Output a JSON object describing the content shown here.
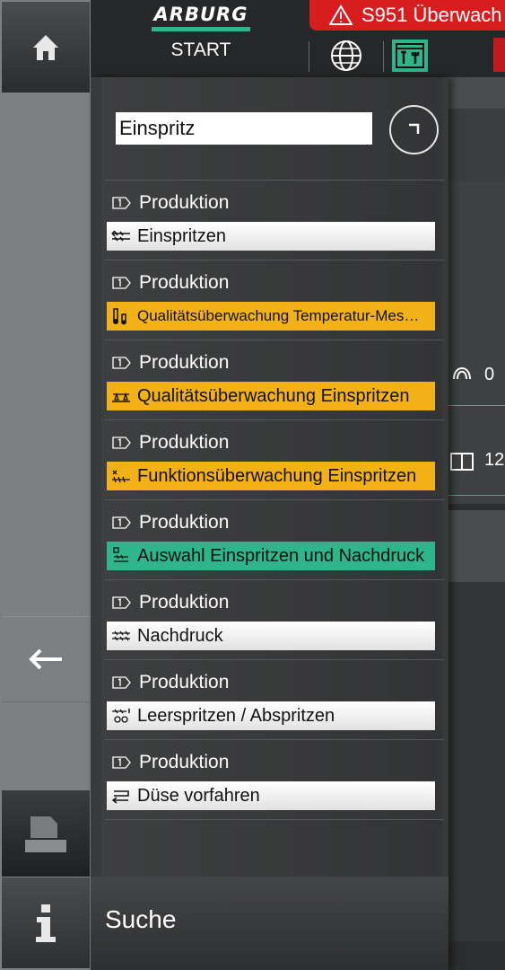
{
  "header": {
    "logo": "ARBURG",
    "start_label": "START",
    "alarm_text": "S951 Überwach"
  },
  "background": {
    "value_a": "0",
    "value_b": "12"
  },
  "search": {
    "value": "Einspritz"
  },
  "results": [
    {
      "crumb": "Produktion",
      "label": "Einspritzen",
      "style": "white",
      "icon": "injection-icon"
    },
    {
      "crumb": "Produktion",
      "label": "Qualitätsüberwachung Temperatur-Mes…",
      "style": "yellow",
      "icon": "temperature-icon"
    },
    {
      "crumb": "Produktion",
      "label": "Qualitätsüberwachung Einspritzen",
      "style": "yellow",
      "icon": "quality-scale-icon"
    },
    {
      "crumb": "Produktion",
      "label": "Funktionsüberwachung Einspritzen",
      "style": "yellow",
      "icon": "function-monitor-icon"
    },
    {
      "crumb": "Produktion",
      "label": "Auswahl Einspritzen und Nachdruck",
      "style": "green",
      "icon": "selection-icon"
    },
    {
      "crumb": "Produktion",
      "label": "Nachdruck",
      "style": "white",
      "icon": "holding-pressure-icon"
    },
    {
      "crumb": "Produktion",
      "label": "Leerspritzen / Abspritzen",
      "style": "white",
      "icon": "purge-icon"
    },
    {
      "crumb": "Produktion",
      "label": "Düse vorfahren",
      "style": "white",
      "icon": "nozzle-forward-icon"
    }
  ],
  "footer": {
    "title": "Suche"
  },
  "colors": {
    "accent_green": "#2fb58a",
    "alarm_red": "#d81d1f",
    "warning_yellow": "#f3b118"
  }
}
